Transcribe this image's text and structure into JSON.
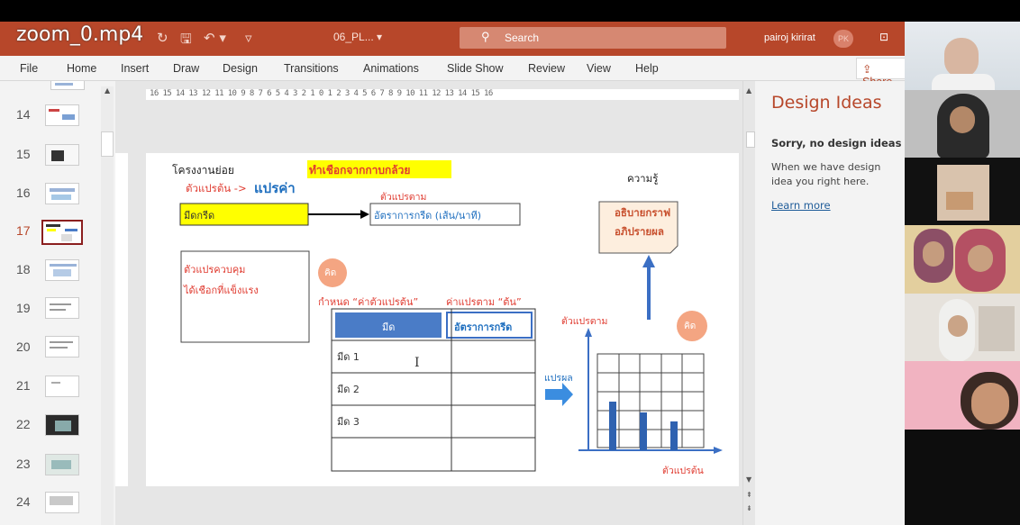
{
  "overlay_title": "zoom_0.mp4",
  "window": {
    "doc_name": "06_PL... ▾",
    "search_placeholder": "Search",
    "user_name": "pairoj kirirat",
    "user_initials": "PK"
  },
  "menu": [
    "File",
    "Home",
    "Insert",
    "Draw",
    "Design",
    "Transitions",
    "Animations",
    "Slide Show",
    "Review",
    "View",
    "Help"
  ],
  "share_label": "Share",
  "ruler_text": "16 15 14 13 12 11 10 9 8 7 6 5 4 3 2 1 0 1 2 3 4 5 6 7 8 9 10 11 12 13 14 15 16",
  "thumbnails": [
    {
      "num": "14"
    },
    {
      "num": "15"
    },
    {
      "num": "16"
    },
    {
      "num": "17"
    },
    {
      "num": "18"
    },
    {
      "num": "19"
    },
    {
      "num": "20"
    },
    {
      "num": "21"
    },
    {
      "num": "22"
    },
    {
      "num": "23"
    },
    {
      "num": "24"
    }
  ],
  "slide": {
    "title_prefix": "โครงงานย่อย",
    "title_highlight": "ทำเชือกจากกาบกล้วย",
    "indep_label": "ตัวแปรต้น ->",
    "indep_action": "แปรค่า",
    "box_knife": "มีดกรีด",
    "dep_label": "ตัวแปรตาม",
    "dep_box": "อัตราการกรีด (เส้น/นาที)",
    "control_line1": "ตัวแปรควบคุม",
    "control_line2": "ได้เชือกที่แข็งแรง",
    "think_badge": "คิด",
    "knowledge": "ความรู้",
    "explain_line1": "อธิบายกราฟ",
    "explain_line2": "อภิปรายผล",
    "set_label_1": "กำหนด “ค่าตัวแปรต้น”",
    "set_label_2": "ค่าแปรตาม “ต้น”",
    "table_headers": [
      "มีด",
      "อัตราการกรีด"
    ],
    "table_rows": [
      "มีด 1",
      "มีด 2",
      "มีด 3",
      ""
    ],
    "graph_y_label": "ตัวแปรตาม",
    "graph_x_label": "ตัวแปรต้น",
    "interpret_label": "แปรผล"
  },
  "design_ideas": {
    "title": "Design Ideas",
    "subtitle": "Sorry, no design ideas for",
    "body": "When we have design idea you right here.",
    "link": "Learn more"
  },
  "colors": {
    "brand": "#b7472a",
    "highlight_yellow": "#ffff00",
    "slide_red": "#e03c31",
    "slide_blue": "#1f6fbf",
    "think_badge": "#f4a582",
    "table_header": "#4a7cc7"
  }
}
